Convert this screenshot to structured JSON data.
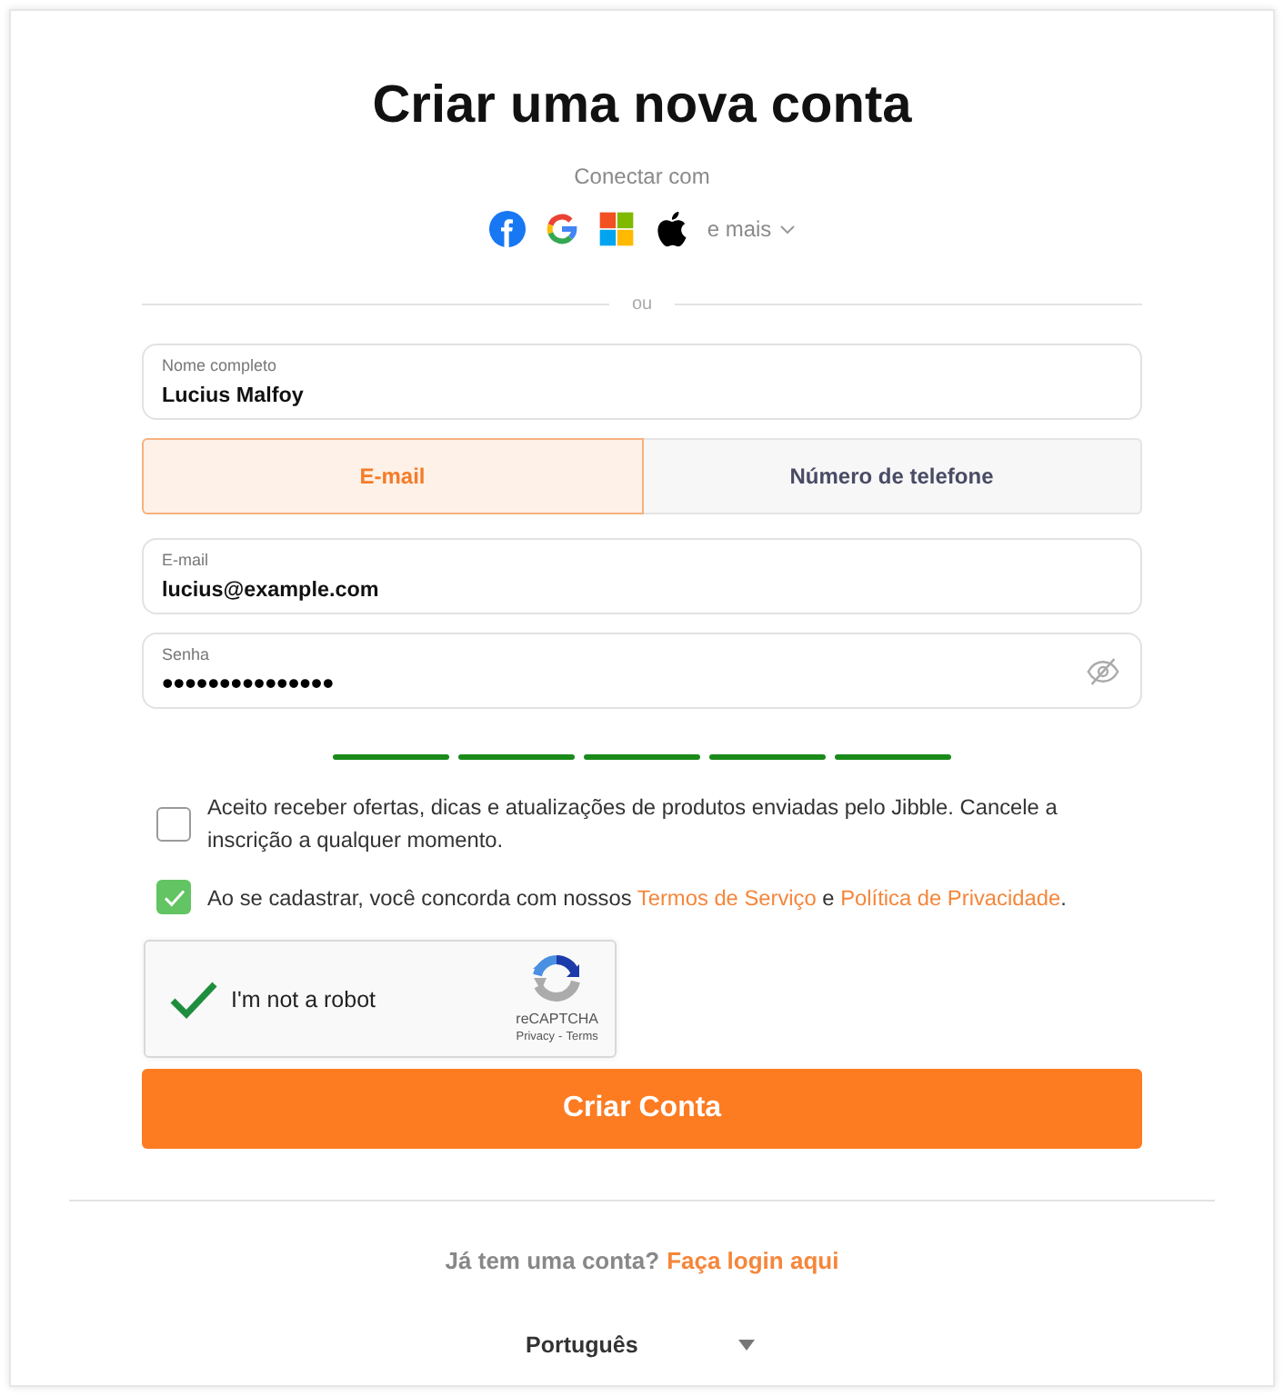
{
  "title": "Criar uma nova conta",
  "social": {
    "label": "Conectar com",
    "providers": [
      {
        "kind": "facebook"
      },
      {
        "kind": "google"
      },
      {
        "kind": "microsoft"
      },
      {
        "kind": "apple"
      }
    ],
    "more": "e mais"
  },
  "separator": "ou",
  "name_field": {
    "label": "Nome completo",
    "value": "Lucius Malfoy"
  },
  "tabs": [
    {
      "label": "E-mail",
      "selected": true
    },
    {
      "label": "Número de telefone",
      "selected": false
    }
  ],
  "email_field": {
    "label": "E-mail",
    "value": "lucius@example.com"
  },
  "password_field": {
    "label": "Senha",
    "value": "•••••••••••••••",
    "visible": false
  },
  "password_strength": {
    "segments": [
      {
        "filled": true
      },
      {
        "filled": true
      },
      {
        "filled": true
      },
      {
        "filled": true
      },
      {
        "filled": true
      }
    ]
  },
  "consents": [
    {
      "checked": false,
      "parts": [
        {
          "kind": "text",
          "text": "Aceito receber ofertas, dicas e atualizações de produtos enviadas pelo Jibble. Cancele a inscrição a qualquer momento."
        }
      ]
    },
    {
      "checked": true,
      "parts": [
        {
          "kind": "text",
          "text": "Ao se cadastrar, você concorda com nossos "
        },
        {
          "kind": "link",
          "text": "Termos de Serviço"
        },
        {
          "kind": "text",
          "text": " e "
        },
        {
          "kind": "link",
          "text": "Política de Privacidade"
        },
        {
          "kind": "text",
          "text": "."
        }
      ]
    }
  ],
  "captcha": {
    "checked": true,
    "label": "I'm not a robot",
    "brand": "reCAPTCHA",
    "links": [
      "Privacy",
      "Terms"
    ],
    "link_separator": "-"
  },
  "submit": "Criar Conta",
  "login_prompt": {
    "text": "Já tem uma conta?",
    "link": "Faça login aqui"
  },
  "language": {
    "value": "Português"
  }
}
